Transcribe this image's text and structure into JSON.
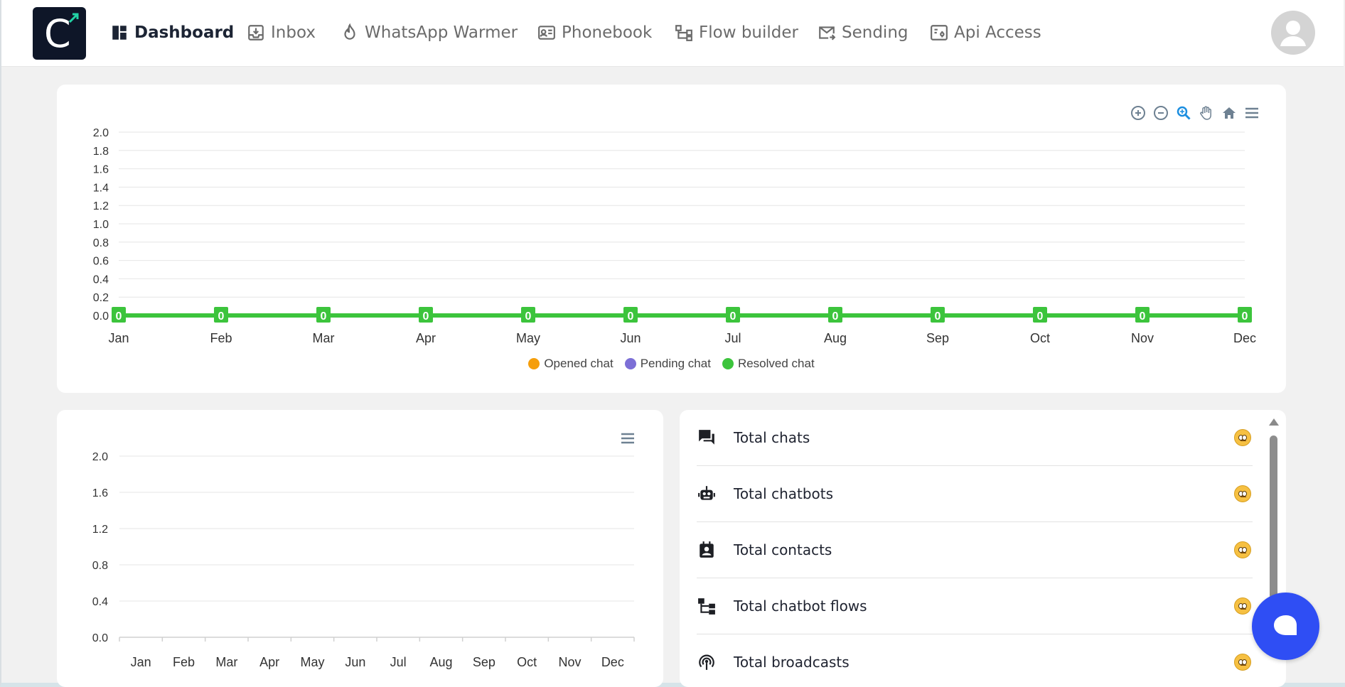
{
  "nav": {
    "logo_letter": "C",
    "items": [
      {
        "label": "Dashboard",
        "icon": "dashboard-icon",
        "active": true
      },
      {
        "label": "Inbox",
        "icon": "inbox-icon",
        "active": false
      },
      {
        "label": "WhatsApp Warmer",
        "icon": "flame-icon",
        "active": false
      },
      {
        "label": "Phonebook",
        "icon": "contact-card-icon",
        "active": false
      },
      {
        "label": "Flow builder",
        "icon": "flow-icon",
        "active": false
      },
      {
        "label": "Sending",
        "icon": "mail-send-icon",
        "active": false
      },
      {
        "label": "Api Access",
        "icon": "api-icon",
        "active": false
      }
    ]
  },
  "legend": {
    "opened": "Opened chat",
    "pending": "Pending chat",
    "resolved": "Resolved chat"
  },
  "colors": {
    "opened": "#f59e0b",
    "pending": "#7c6fd6",
    "resolved": "#3cc43c",
    "accent": "#2f4ef4"
  },
  "chart_data": [
    {
      "type": "line",
      "x": [
        "Jan",
        "Feb",
        "Mar",
        "Apr",
        "May",
        "Jun",
        "Jul",
        "Aug",
        "Sep",
        "Oct",
        "Nov",
        "Dec"
      ],
      "series": [
        {
          "name": "Opened chat",
          "values": [
            0,
            0,
            0,
            0,
            0,
            0,
            0,
            0,
            0,
            0,
            0,
            0
          ]
        },
        {
          "name": "Pending chat",
          "values": [
            0,
            0,
            0,
            0,
            0,
            0,
            0,
            0,
            0,
            0,
            0,
            0
          ]
        },
        {
          "name": "Resolved chat",
          "values": [
            0,
            0,
            0,
            0,
            0,
            0,
            0,
            0,
            0,
            0,
            0,
            0
          ]
        }
      ],
      "yticks": [
        "0.0",
        "0.2",
        "0.4",
        "0.6",
        "0.8",
        "1.0",
        "1.2",
        "1.4",
        "1.6",
        "1.8",
        "2.0"
      ],
      "ylim": [
        0,
        2
      ],
      "data_labels": [
        "0",
        "0",
        "0",
        "0",
        "0",
        "0",
        "0",
        "0",
        "0",
        "0",
        "0",
        "0"
      ],
      "grid": true,
      "legend_position": "bottom"
    },
    {
      "type": "bar",
      "categories": [
        "Jan",
        "Feb",
        "Mar",
        "Apr",
        "May",
        "Jun",
        "Jul",
        "Aug",
        "Sep",
        "Oct",
        "Nov",
        "Dec"
      ],
      "values": [
        0,
        0,
        0,
        0,
        0,
        0,
        0,
        0,
        0,
        0,
        0,
        0
      ],
      "yticks": [
        "0.0",
        "0.4",
        "0.8",
        "1.2",
        "1.6",
        "2.0"
      ],
      "ylim": [
        0,
        2
      ],
      "grid": true
    }
  ],
  "stats": [
    {
      "label": "Total chats",
      "icon": "chat-bubbles-icon"
    },
    {
      "label": "Total chatbots",
      "icon": "robot-icon"
    },
    {
      "label": "Total contacts",
      "icon": "contact-book-icon"
    },
    {
      "label": "Total chatbot flows",
      "icon": "flow-icon"
    },
    {
      "label": "Total broadcasts",
      "icon": "broadcast-icon"
    }
  ]
}
